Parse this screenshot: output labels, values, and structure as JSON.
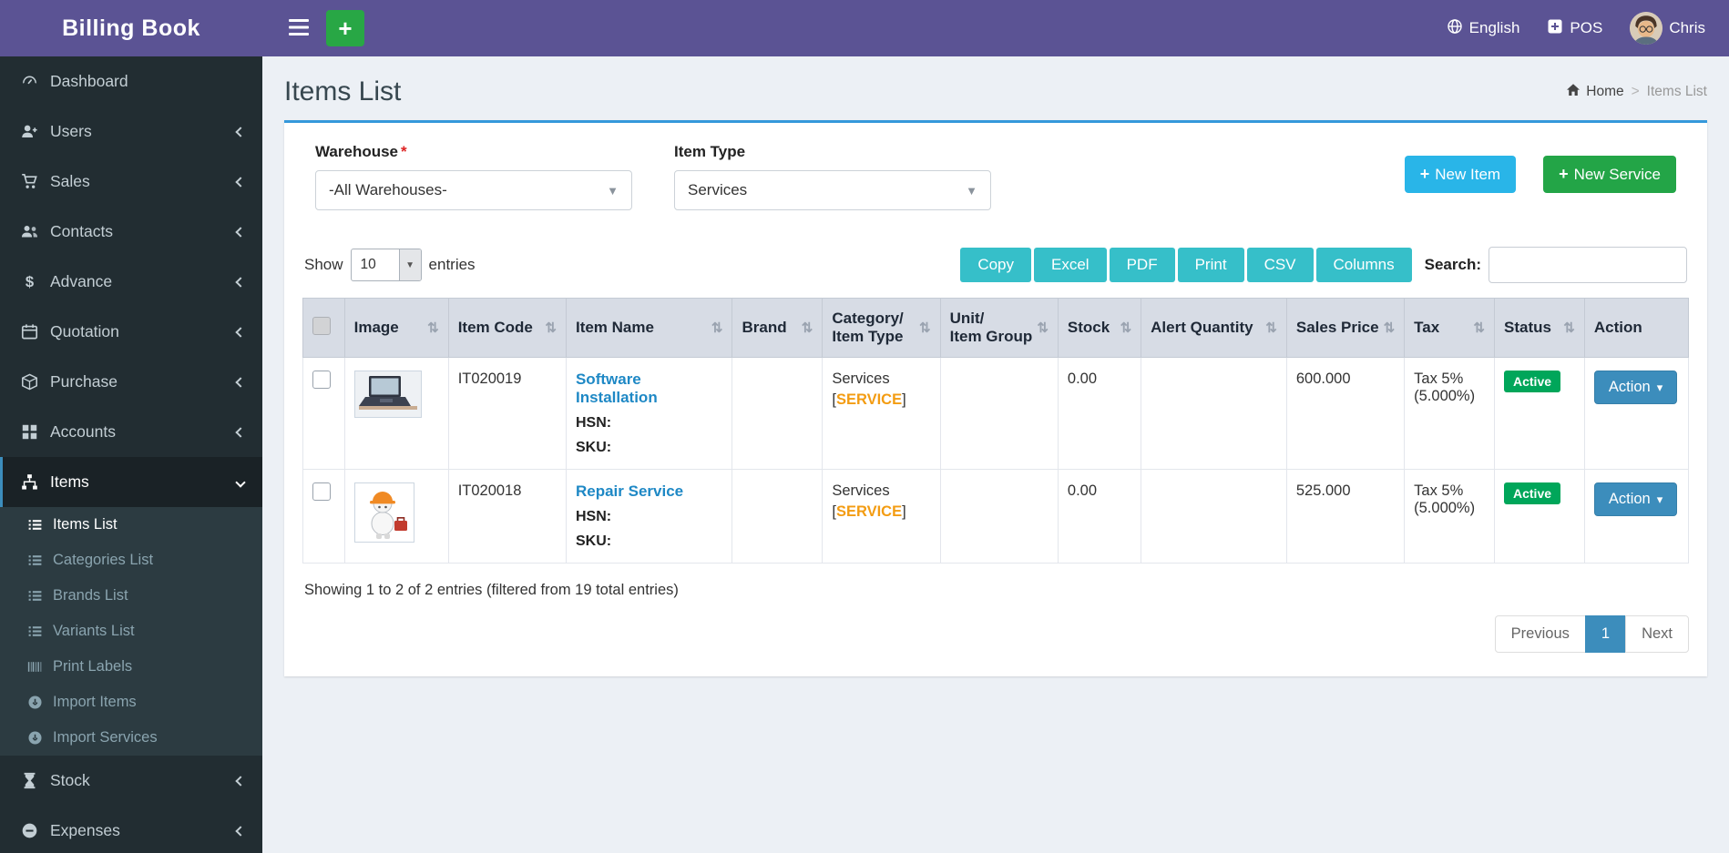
{
  "app": {
    "title": "Billing Book"
  },
  "topbar": {
    "language": "English",
    "pos_label": "POS",
    "user_name": "Chris"
  },
  "sidebar": {
    "items": [
      {
        "label": "Dashboard"
      },
      {
        "label": "Users"
      },
      {
        "label": "Sales"
      },
      {
        "label": "Contacts"
      },
      {
        "label": "Advance"
      },
      {
        "label": "Quotation"
      },
      {
        "label": "Purchase"
      },
      {
        "label": "Accounts"
      },
      {
        "label": "Items"
      },
      {
        "label": "Stock"
      },
      {
        "label": "Expenses"
      }
    ],
    "items_submenu": [
      {
        "label": "Items List"
      },
      {
        "label": "Categories List"
      },
      {
        "label": "Brands List"
      },
      {
        "label": "Variants List"
      },
      {
        "label": "Print Labels"
      },
      {
        "label": "Import Items"
      },
      {
        "label": "Import Services"
      }
    ]
  },
  "page": {
    "title": "Items List",
    "breadcrumb_home": "Home",
    "breadcrumb_separator": ">",
    "breadcrumb_current": "Items List"
  },
  "filters": {
    "warehouse_label": "Warehouse",
    "required_mark": "*",
    "warehouse_value": "-All Warehouses-",
    "item_type_label": "Item Type",
    "item_type_value": "Services",
    "new_item_label": "New Item",
    "new_service_label": "New Service"
  },
  "controls": {
    "show_label": "Show",
    "page_length": "10",
    "entries_label": "entries",
    "buttons": [
      "Copy",
      "Excel",
      "PDF",
      "Print",
      "CSV",
      "Columns"
    ],
    "search_label": "Search:",
    "search_value": ""
  },
  "table": {
    "headers": [
      "Image",
      "Item Code",
      "Item Name",
      "Brand",
      "Category/\nItem Type",
      "Unit/\nItem Group",
      "Stock",
      "Alert Quantity",
      "Sales Price",
      "Tax",
      "Status",
      "Action"
    ],
    "rows": [
      {
        "image": "laptop-photo",
        "item_code": "IT020019",
        "item_name": "Software Installation",
        "hsn_label": "HSN:",
        "hsn_value": "",
        "sku_label": "SKU:",
        "sku_value": "",
        "brand": "",
        "category": "Services",
        "tag_open": "[",
        "tag": "SERVICE",
        "tag_close": "]",
        "unit_group": "",
        "stock": "0.00",
        "alert_quantity": "",
        "sales_price": "600.000",
        "tax_name": "Tax 5%",
        "tax_rate": "(5.000%)",
        "status": "Active",
        "action_label": "Action"
      },
      {
        "image": "repair-mascot",
        "item_code": "IT020018",
        "item_name": "Repair Service",
        "hsn_label": "HSN:",
        "hsn_value": "",
        "sku_label": "SKU:",
        "sku_value": "",
        "brand": "",
        "category": "Services",
        "tag_open": "[",
        "tag": "SERVICE",
        "tag_close": "]",
        "unit_group": "",
        "stock": "0.00",
        "alert_quantity": "",
        "sales_price": "525.000",
        "tax_name": "Tax 5%",
        "tax_rate": "(5.000%)",
        "status": "Active",
        "action_label": "Action"
      }
    ]
  },
  "summary": {
    "info": "Showing 1 to 2 of 2 entries (filtered from 19 total entries)"
  },
  "pagination": {
    "previous": "Previous",
    "page": "1",
    "next": "Next"
  },
  "glyphs": {
    "plus": "+",
    "sort": "⇅",
    "caret_down": "▾",
    "select_caret": "▼"
  },
  "icons": {
    "menu-icon": "hamburger-bars",
    "add-icon": "plus",
    "language-icon": "globe",
    "pos-icon": "plus-square",
    "home-icon": "house",
    "sort-icon": "up-down-arrows",
    "dashboard-icon": "gauge",
    "users-icon": "person-plus",
    "sales-icon": "cart",
    "contacts-icon": "people",
    "advance-icon": "dollar",
    "quotation-icon": "calendar",
    "purchase-icon": "cube",
    "accounts-icon": "grid",
    "items-icon": "sitemap",
    "stock-icon": "hourglass",
    "expenses-icon": "minus-circle",
    "list-icon": "list-lines",
    "barcode-icon": "barcode",
    "import-icon": "download-circle"
  },
  "colors": {
    "header_purple": "#5b5394",
    "sidebar_dark": "#222d32",
    "accent_blue": "#3c8dbc",
    "card_top_blue": "#3598db",
    "cyan_button": "#36bfc9",
    "new_item_blue": "#29b5e8",
    "green": "#28a745",
    "badge_green": "#00a65a",
    "orange_tag": "#f39c12",
    "link_blue": "#1e88c5"
  }
}
